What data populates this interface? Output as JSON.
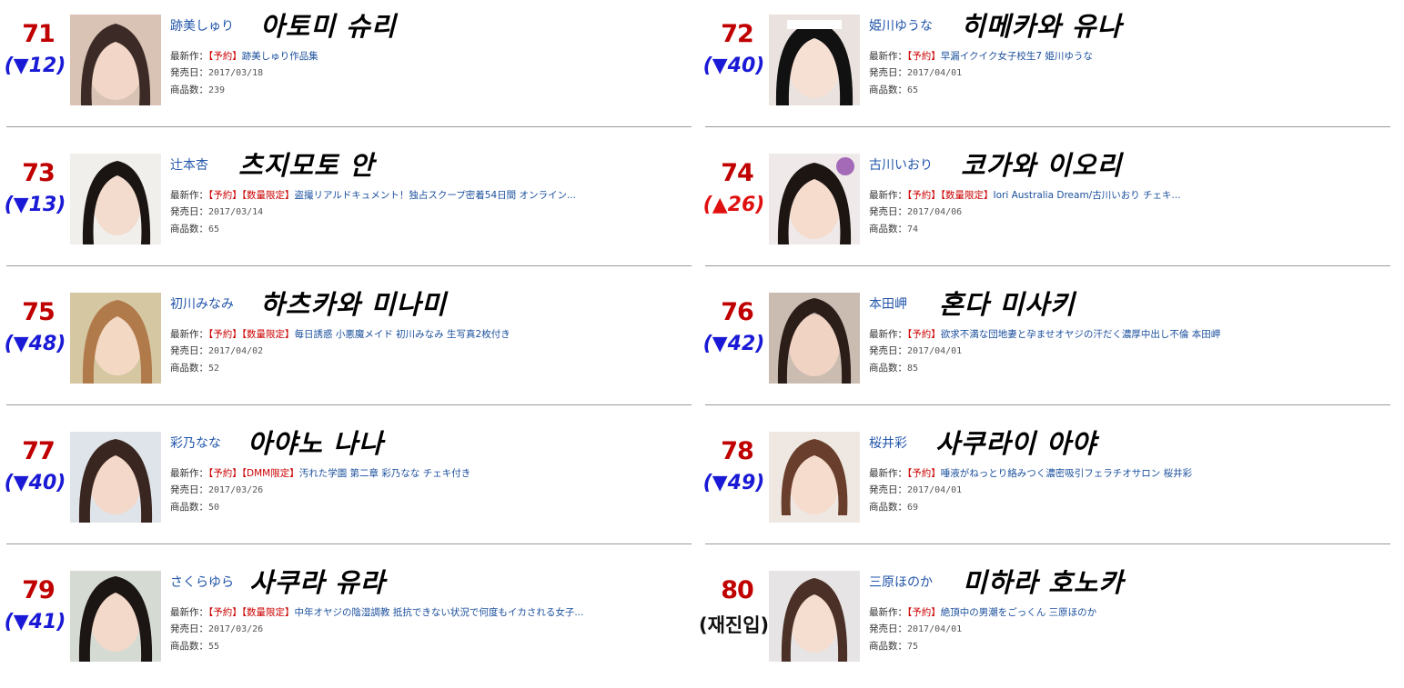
{
  "labels": {
    "latest": "最新作：",
    "release": "発売日：",
    "count": "商品数："
  },
  "colors": {
    "rank": "#c00000",
    "down": "#1a1ad6",
    "up": "#e01010",
    "link": "#1a4f9c",
    "tag": "#cc0000"
  },
  "entries": [
    {
      "rank": "71",
      "change": "(▼12)",
      "dir": "down",
      "name_jp": "跡美しゅり",
      "name_kr": "아토미 슈리",
      "tag": "【予約】",
      "title": "跡美しゅり作品集",
      "release": "2017/03/18",
      "count": "239"
    },
    {
      "rank": "72",
      "change": "(▼40)",
      "dir": "down",
      "name_jp": "姫川ゆうな",
      "name_kr": "히메카와 유나",
      "tag": "【予約】",
      "title": "早漏イクイク女子校生7 姫川ゆうな",
      "release": "2017/04/01",
      "count": "65"
    },
    {
      "rank": "73",
      "change": "(▼13)",
      "dir": "down",
      "name_jp": "辻本杏",
      "name_kr": "츠지모토 안",
      "tag": "【予約】【数量限定】",
      "title": "盗撮リアルドキュメント！独占スクープ密着54日間 オンライン...",
      "release": "2017/03/14",
      "count": "65"
    },
    {
      "rank": "74",
      "change": "(▲26)",
      "dir": "up",
      "name_jp": "古川いおり",
      "name_kr": "코가와 이오리",
      "tag": "【予約】【数量限定】",
      "title": "Iori Australia Dream/古川いおり チェキ...",
      "release": "2017/04/06",
      "count": "74"
    },
    {
      "rank": "75",
      "change": "(▼48)",
      "dir": "down",
      "name_jp": "初川みなみ",
      "name_kr": "하츠카와 미나미",
      "tag": "【予約】【数量限定】",
      "title": "毎日誘惑 小悪魔メイド 初川みなみ 生写真2枚付き",
      "release": "2017/04/02",
      "count": "52"
    },
    {
      "rank": "76",
      "change": "(▼42)",
      "dir": "down",
      "name_jp": "本田岬",
      "name_kr": "혼다 미사키",
      "tag": "【予約】",
      "title": "欲求不満な団地妻と孕ませオヤジの汗だく濃厚中出し不倫 本田岬",
      "release": "2017/04/01",
      "count": "85"
    },
    {
      "rank": "77",
      "change": "(▼40)",
      "dir": "down",
      "name_jp": "彩乃なな",
      "name_kr": "아야노 나나",
      "tag": "【予約】【DMM限定】",
      "title": "汚れた学園 第二章 彩乃なな チェキ付き",
      "release": "2017/03/26",
      "count": "50"
    },
    {
      "rank": "78",
      "change": "(▼49)",
      "dir": "down",
      "name_jp": "桜井彩",
      "name_kr": "사쿠라이 아야",
      "tag": "【予約】",
      "title": "唾液がねっとり絡みつく濃密吸引フェラチオサロン 桜井彩",
      "release": "2017/04/01",
      "count": "69"
    },
    {
      "rank": "79",
      "change": "(▼41)",
      "dir": "down",
      "name_jp": "さくらゆら",
      "name_kr": "사쿠라 유라",
      "tag": "【予約】【数量限定】",
      "title": "中年オヤジの陰湿調教 抵抗できない状況で何度もイカされる女子...",
      "release": "2017/03/26",
      "count": "55"
    },
    {
      "rank": "80",
      "change": "(재진입)",
      "dir": "re",
      "name_jp": "三原ほのか",
      "name_kr": "미하라 호노카",
      "tag": "【予約】",
      "title": "絶頂中の男潮をごっくん 三原ほのか",
      "release": "2017/04/01",
      "count": "75"
    }
  ]
}
